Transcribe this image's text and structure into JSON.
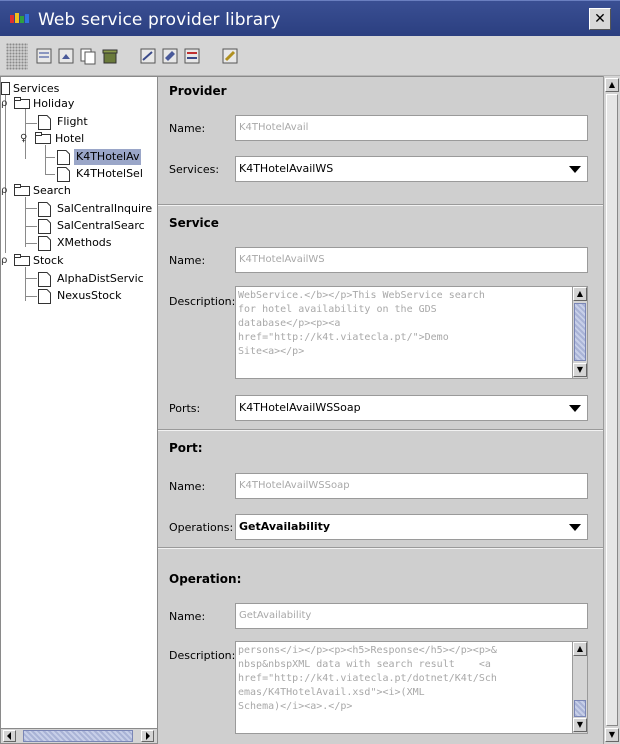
{
  "window": {
    "title": "Web service provider library",
    "close_glyph": "✕"
  },
  "toolbar": {
    "buttons": [
      "new-service-icon",
      "import-icon",
      "copy-icon",
      "delete-icon",
      "search-icon",
      "edit-icon",
      "publish-icon",
      "help-icon"
    ]
  },
  "tree": {
    "root": "Services",
    "nodes": {
      "holiday": "Holiday",
      "flight": "Flight",
      "hotel": "Hotel",
      "hotel_avail": "K4THotelAv",
      "hotel_sel": "K4THotelSel",
      "search": "Search",
      "sal_inquire": "SalCentralInquire",
      "sal_search": "SalCentralSearc",
      "xmethods": "XMethods",
      "stock": "Stock",
      "alpha": "AlphaDistServic",
      "nexus": "NexusStock"
    }
  },
  "provider": {
    "heading": "Provider",
    "name_label": "Name:",
    "name_value": "K4THotelAvail",
    "services_label": "Services:",
    "services_value": "K4THotelAvailWS"
  },
  "service": {
    "heading": "Service",
    "name_label": "Name:",
    "name_value": "K4THotelAvailWS",
    "description_label": "Description:",
    "description_value": "WebService.</b></p>This WebService search\nfor hotel availability on the GDS\ndatabase</p><p><a\nhref=\"http://k4t.viatecla.pt/\">Demo\nSite<a></p>",
    "ports_label": "Ports:",
    "ports_value": "K4THotelAvailWSSoap"
  },
  "port": {
    "heading": "Port:",
    "name_label": "Name:",
    "name_value": "K4THotelAvailWSSoap",
    "operations_label": "Operations:",
    "operations_value": "GetAvailability"
  },
  "operation": {
    "heading": "Operation:",
    "name_label": "Name:",
    "name_value": "GetAvailability",
    "description_label": "Description:",
    "description_value": "persons</i></p><p><h5>Response</h5></p><p>&\nnbsp&nbspXML data with search result    <a\nhref=\"http://k4t.viatecla.pt/dotnet/K4t/Sch\nemas/K4THotelAvail.xsd\"><i>(XML\nSchema)</i><a>.</p>"
  },
  "colors": {
    "titlebar": "#2b3f80",
    "selection": "#9aa6c8",
    "panel": "#cfcfcf"
  }
}
